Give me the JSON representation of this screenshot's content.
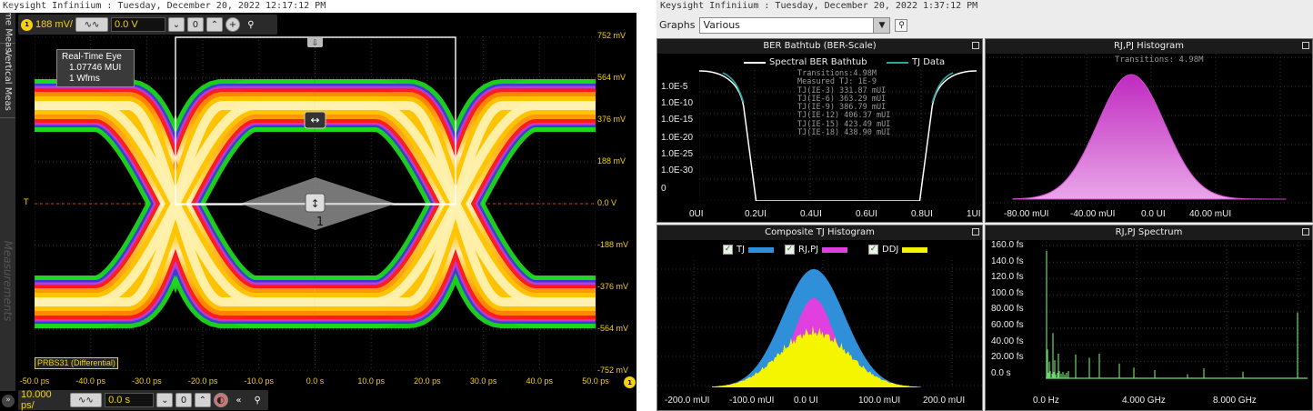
{
  "scope": {
    "title": "Keysight Infiniium : Tuesday, December 20, 2022 12:17:12 PM",
    "side_tabs": [
      "Time Meas",
      "Vertical Meas"
    ],
    "watermark": "Measurements",
    "vertical": {
      "channel_badge": "1",
      "scale": "188 mV/",
      "offset": "0.0 V"
    },
    "horizontal": {
      "scale": "10.000 ps/",
      "position": "0.0 s",
      "badge": "1"
    },
    "y_ticks": [
      "752 mV",
      "564 mV",
      "376 mV",
      "188 mV",
      "0.0 V",
      "-188 mV",
      "-376 mV",
      "-564 mV",
      "-752 mV"
    ],
    "x_ticks": [
      "-50.0 ps",
      "-40.0 ps",
      "-30.0 ps",
      "-20.0 ps",
      "-10.0 ps",
      "0.0 s",
      "10.0 ps",
      "20.0 ps",
      "30.0 ps",
      "40.0 ps",
      "50.0 ps"
    ],
    "eye_info": {
      "title": "Real-Time Eye",
      "mui": "1.07746 MUI",
      "wfms": "1 Wfms"
    },
    "waveform_label": "PRBS31 (Differential)",
    "mask_label": "1",
    "trigger_marker": "T"
  },
  "jitter": {
    "title": "Keysight Infiniium : Tuesday, December 20, 2022 1:37:12 PM",
    "graphs_label": "Graphs",
    "graphs_selected": "Various",
    "bathtub": {
      "title": "BER Bathtub (BER-Scale)",
      "legend": [
        "Spectral BER Bathtub",
        "TJ Data"
      ],
      "y_ticks": [
        "1.0E-5",
        "1.0E-10",
        "1.0E-15",
        "1.0E-20",
        "1.0E-25",
        "1.0E-30",
        "0"
      ],
      "x_ticks": [
        "0UI",
        "0.2UI",
        "0.4UI",
        "0.6UI",
        "0.8UI",
        "1UI"
      ],
      "annotations": [
        "Transitions:4.98M",
        "Measured TJ: 1E-9",
        "TJ(IE-3) 331.87 mUI",
        "TJ(IE-6) 363.29 mUI",
        "TJ(IE-9) 386.79 mUI",
        "TJ(IE-12) 406.37 mUI",
        "TJ(IE-15) 423.49 mUI",
        "TJ(IE-18) 438.90 mUI"
      ]
    },
    "rjpj_hist": {
      "title": "RJ,PJ Histogram",
      "annotation": "Transitions: 4.98M",
      "x_ticks": [
        "-80.00 mUI",
        "-40.00 mUI",
        "0.0 UI",
        "40.00 mUI"
      ]
    },
    "composite": {
      "title": "Composite TJ Histogram",
      "legend": [
        {
          "label": "TJ",
          "color": "#2f8fd8"
        },
        {
          "label": "RJ,PJ",
          "color": "#e040e0"
        },
        {
          "label": "DDJ",
          "color": "#f5f500"
        }
      ],
      "x_ticks": [
        "-200.0 mUI",
        "-100.0 mUI",
        "0.0 UI",
        "100.0 mUI",
        "200.0 mUI"
      ]
    },
    "spectrum": {
      "title": "RJ,PJ Spectrum",
      "y_ticks": [
        "160.0 fs",
        "140.0 fs",
        "120.0 fs",
        "100.0 fs",
        "80.00 fs",
        "60.00 fs",
        "40.00 fs",
        "20.00 fs",
        "0.0 s"
      ],
      "x_ticks": [
        "0.0 Hz",
        "4.000 GHz",
        "8.000 GHz"
      ]
    }
  }
}
